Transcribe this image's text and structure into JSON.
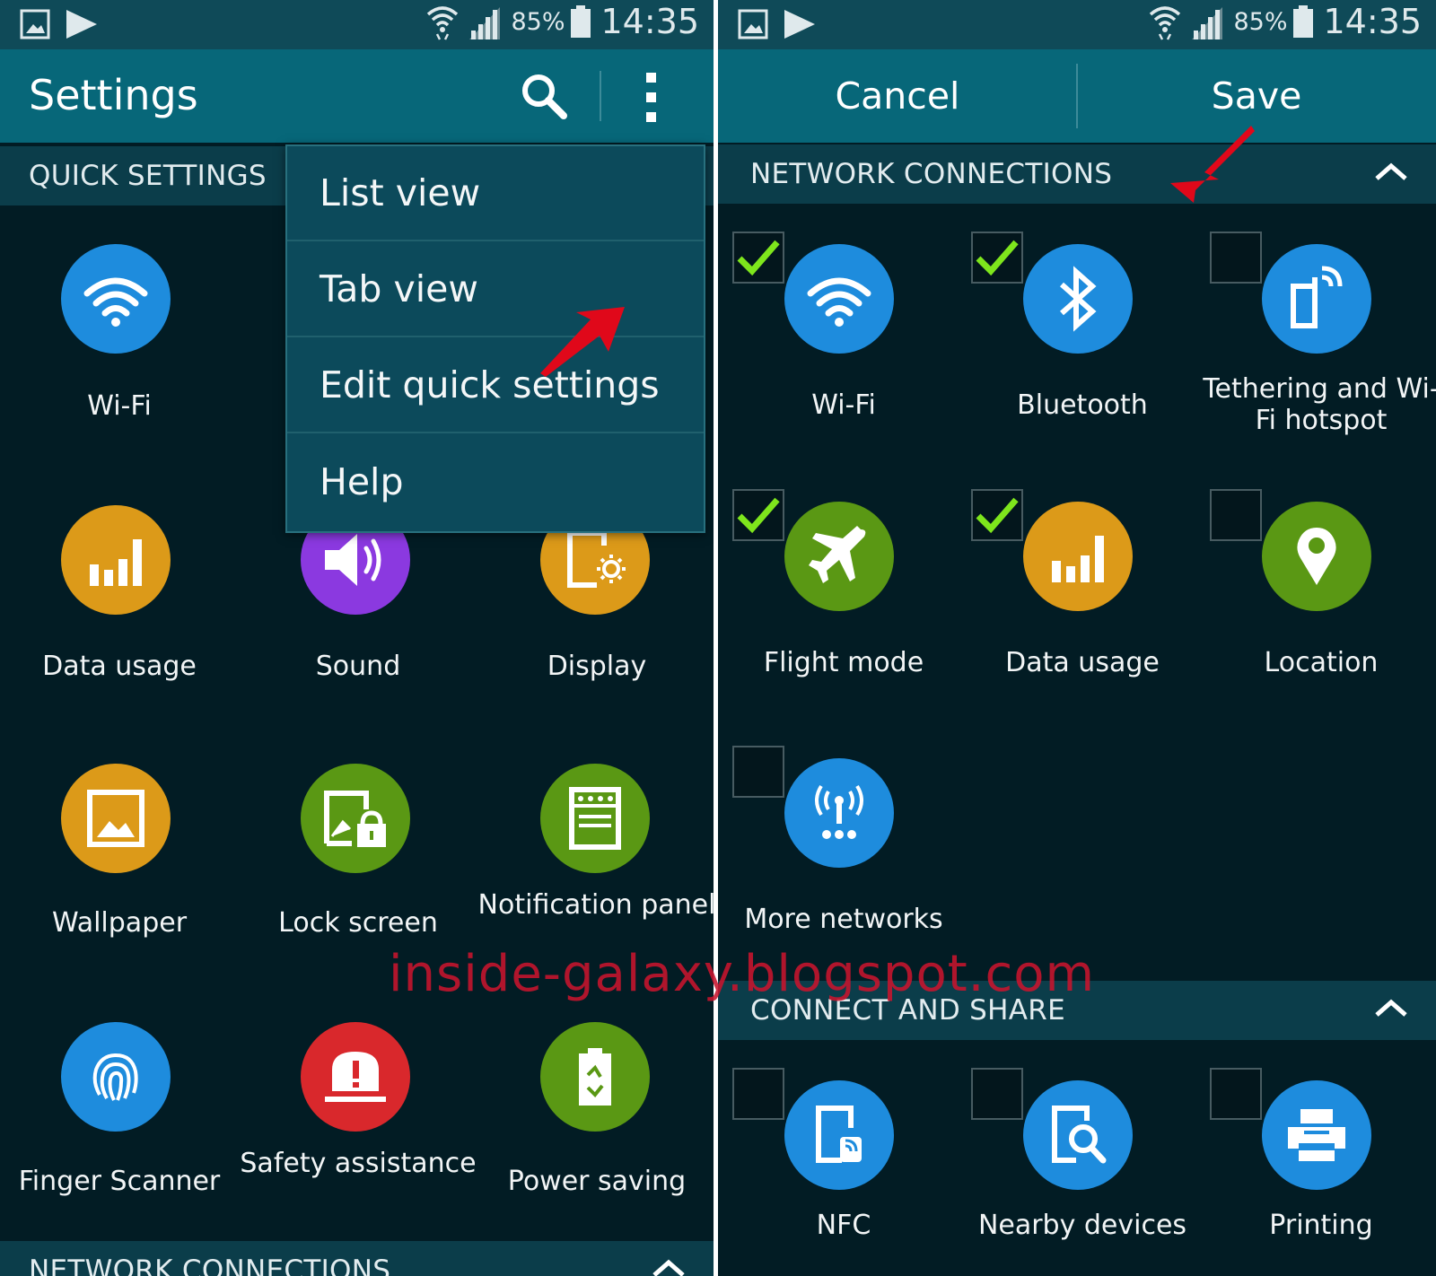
{
  "status_bar": {
    "battery_percent": "85%",
    "time": "14:35"
  },
  "left_screen": {
    "title": "Settings",
    "quick_settings_header": "QUICK SETTINGS",
    "bottom_section_header": "NETWORK CONNECTIONS",
    "overflow_menu": {
      "items": [
        "List view",
        "Tab view",
        "Edit quick settings",
        "Help"
      ]
    },
    "tiles": [
      {
        "label": "Wi-Fi",
        "icon": "wifi-icon",
        "color": "#1e8cdd"
      },
      {
        "label": "Data usage",
        "icon": "data-usage-icon",
        "color": "#dc9a19"
      },
      {
        "label": "Sound",
        "icon": "sound-icon",
        "color": "#8b39e0"
      },
      {
        "label": "Display",
        "icon": "display-icon",
        "color": "#dc9a19"
      },
      {
        "label": "Wallpaper",
        "icon": "wallpaper-icon",
        "color": "#dc9a19"
      },
      {
        "label": "Lock screen",
        "icon": "lock-screen-icon",
        "color": "#5a9814"
      },
      {
        "label": "Notification panel",
        "icon": "notification-panel-icon",
        "color": "#5a9814"
      },
      {
        "label": "Finger Scanner",
        "icon": "fingerprint-icon",
        "color": "#1e8cdd"
      },
      {
        "label": "Safety assistance",
        "icon": "safety-alert-icon",
        "color": "#d9282c"
      },
      {
        "label": "Power saving",
        "icon": "power-saving-icon",
        "color": "#5a9814"
      }
    ]
  },
  "right_screen": {
    "cancel_label": "Cancel",
    "save_label": "Save",
    "network_header": "NETWORK CONNECTIONS",
    "connect_header": "CONNECT AND SHARE",
    "network_tiles": [
      {
        "label": "Wi-Fi",
        "checked": true,
        "icon": "wifi-icon",
        "color": "#1e8cdd"
      },
      {
        "label": "Bluetooth",
        "checked": true,
        "icon": "bluetooth-icon",
        "color": "#1e8cdd"
      },
      {
        "label": "Tethering and Wi-Fi hotspot",
        "checked": false,
        "icon": "hotspot-icon",
        "color": "#1e8cdd"
      },
      {
        "label": "Flight mode",
        "checked": true,
        "icon": "airplane-icon",
        "color": "#5a9814"
      },
      {
        "label": "Data usage",
        "checked": true,
        "icon": "data-usage-icon",
        "color": "#dc9a19"
      },
      {
        "label": "Location",
        "checked": false,
        "icon": "location-icon",
        "color": "#5a9814"
      },
      {
        "label": "More networks",
        "checked": false,
        "icon": "more-networks-icon",
        "color": "#1e8cdd"
      }
    ],
    "connect_tiles": [
      {
        "label": "NFC",
        "checked": false,
        "icon": "nfc-icon",
        "color": "#1e8cdd"
      },
      {
        "label": "Nearby devices",
        "checked": false,
        "icon": "nearby-devices-icon",
        "color": "#1e8cdd"
      },
      {
        "label": "Printing",
        "checked": false,
        "icon": "printer-icon",
        "color": "#1e8cdd"
      }
    ]
  },
  "watermark": "inside-galaxy.blogspot.com"
}
